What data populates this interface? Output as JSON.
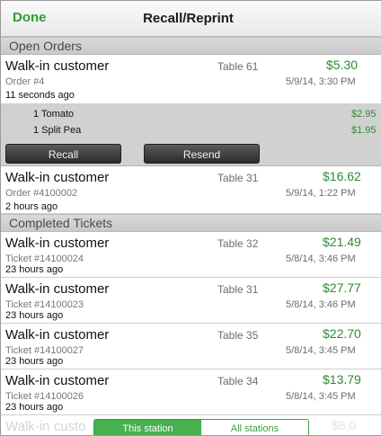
{
  "navbar": {
    "done_label": "Done",
    "title": "Recall/Reprint"
  },
  "open_orders": {
    "header": "Open Orders",
    "orders": [
      {
        "customer": "Walk-in customer",
        "number": "Order #4",
        "ago": "11 seconds ago",
        "table": "Table 61",
        "price": "$5.30",
        "date": "5/9/14, 3:30 PM",
        "items": [
          {
            "name": "1 Tomato",
            "price": "$2.95"
          },
          {
            "name": "1 Split Pea",
            "price": "$1.95"
          }
        ],
        "recall_label": "Recall",
        "resend_label": "Resend"
      },
      {
        "customer": "Walk-in customer",
        "number": "Order #4100002",
        "ago": "2 hours ago",
        "table": "Table 31",
        "price": "$16.62",
        "date": "5/9/14, 1:22 PM"
      }
    ]
  },
  "completed": {
    "header": "Completed Tickets",
    "tickets": [
      {
        "customer": "Walk-in customer",
        "number": "Ticket #14100024",
        "ago": "23 hours ago",
        "table": "Table 32",
        "price": "$21.49",
        "date": "5/8/14, 3:46 PM"
      },
      {
        "customer": "Walk-in customer",
        "number": "Ticket #14100023",
        "ago": "23 hours ago",
        "table": "Table 31",
        "price": "$27.77",
        "date": "5/8/14, 3:46 PM"
      },
      {
        "customer": "Walk-in customer",
        "number": "Ticket #14100027",
        "ago": "23 hours ago",
        "table": "Table 35",
        "price": "$22.70",
        "date": "5/8/14, 3:45 PM"
      },
      {
        "customer": "Walk-in customer",
        "number": "Ticket #14100026",
        "ago": "23 hours ago",
        "table": "Table 34",
        "price": "$13.79",
        "date": "5/8/14, 3:45 PM"
      },
      {
        "customer": "Walk-in custo",
        "price": "$8.0"
      }
    ]
  },
  "station_filter": {
    "this_station": "This station",
    "all_stations": "All stations",
    "selected": "This station"
  },
  "colors": {
    "accent_green": "#2e9e36",
    "price_green": "#2e8b2e",
    "section_gray": "#cfcfcf",
    "button_dark": "#2b2b2b"
  }
}
